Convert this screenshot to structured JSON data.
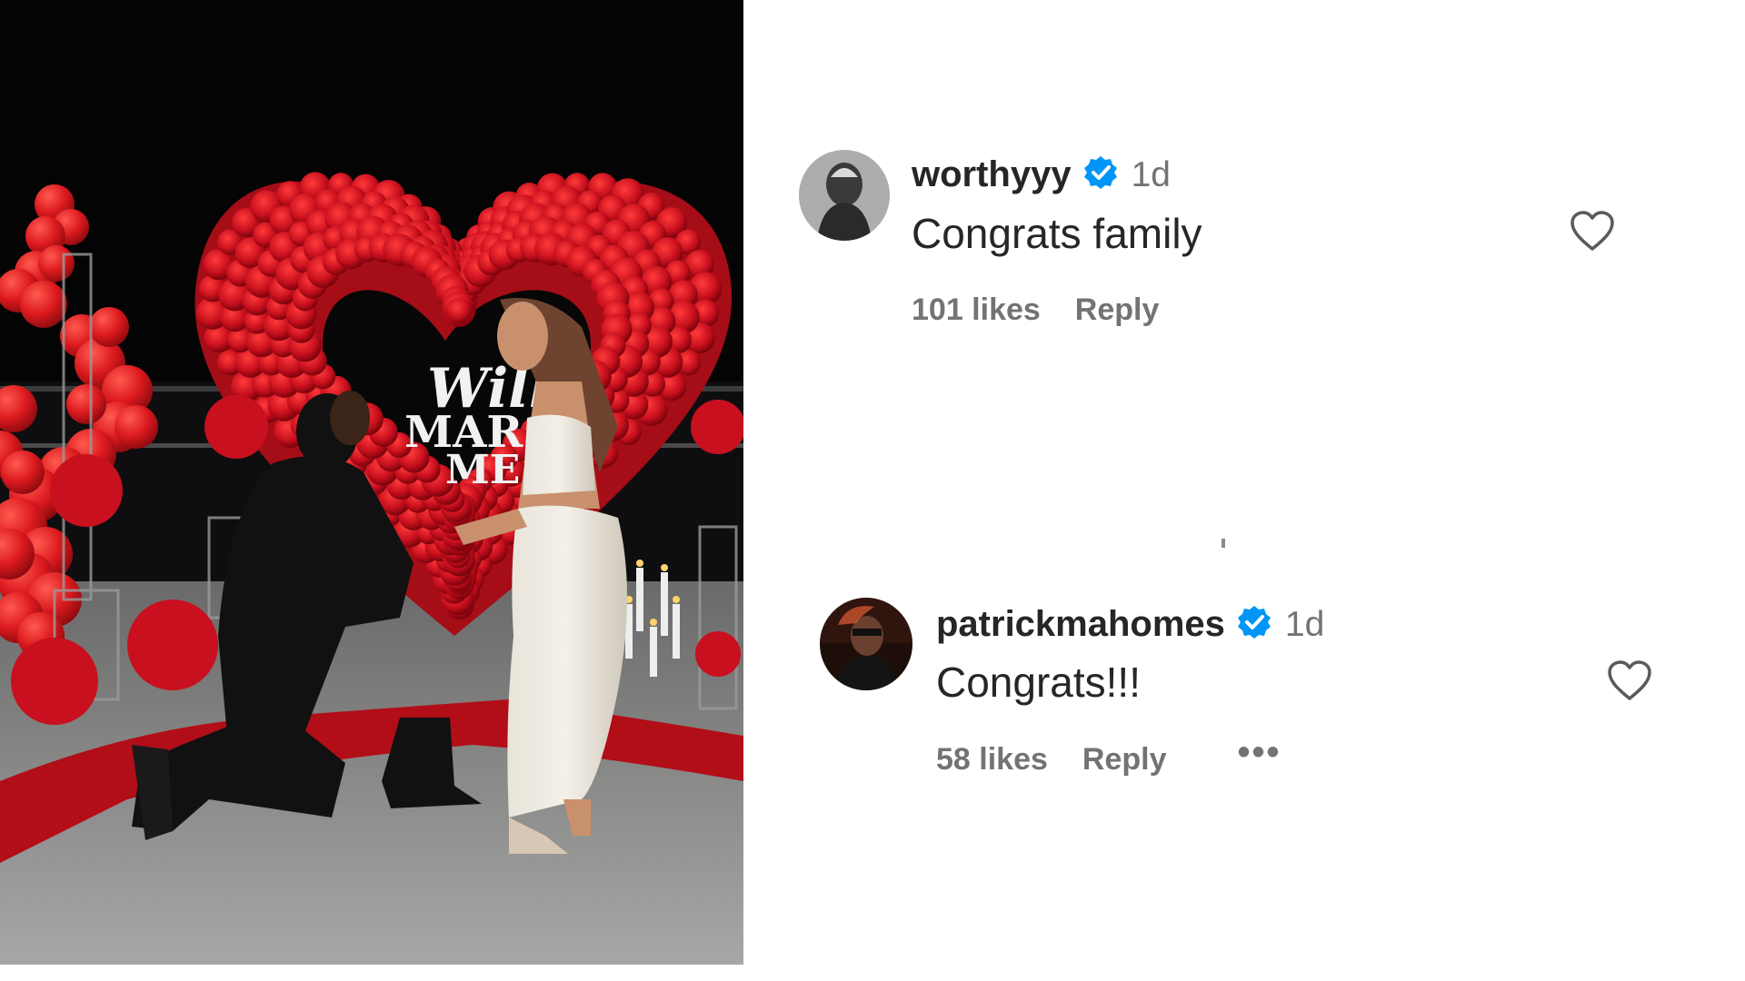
{
  "colors": {
    "text_primary": "#262626",
    "text_secondary": "#737373",
    "verified_blue": "#0095f6",
    "rose_red": "#c8101e",
    "balloon_red": "#d8181f"
  },
  "photo": {
    "description_icon": "proposal-photo",
    "neon_sign_lines": [
      "Will",
      "MAR",
      "ME"
    ]
  },
  "comments": [
    {
      "username": "worthyyy",
      "verified_icon": "verified-badge-icon",
      "time": "1d",
      "text": "Congrats family",
      "likes": "101 likes",
      "reply_label": "Reply",
      "heart_icon": "heart-outline-icon"
    },
    {
      "username": "patrickmahomes",
      "verified_icon": "verified-badge-icon",
      "time": "1d",
      "text": "Congrats!!!",
      "likes": "58 likes",
      "reply_label": "Reply",
      "more_label": "•••",
      "heart_icon": "heart-outline-icon"
    }
  ]
}
